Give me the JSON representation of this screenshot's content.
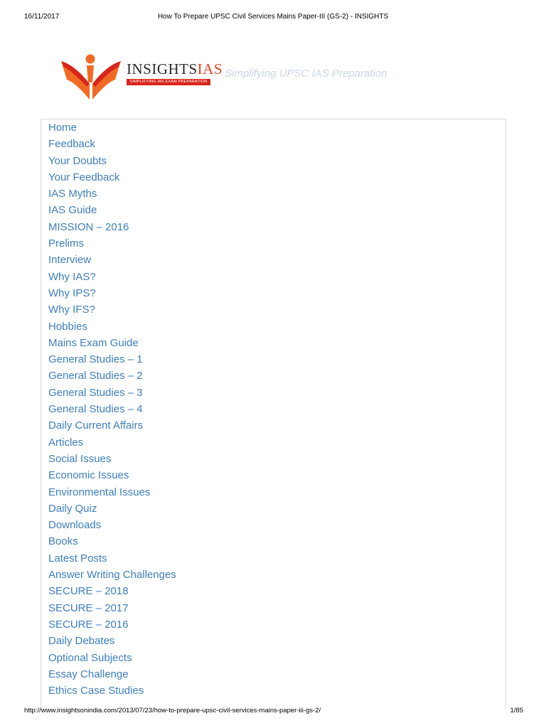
{
  "print_header": {
    "date": "16/11/2017",
    "title": "How To Prepare UPSC Civil Services Mains Paper-III (GS-2) - INSIGHTS"
  },
  "logo": {
    "name_main": "INSIGHTS",
    "name_accent": "IAS",
    "banner": "SIMPLIFYING IAS EXAM PREPARATION",
    "icon": "person-reading-book-icon",
    "colors": {
      "orange": "#f06a23",
      "red": "#d8251c"
    }
  },
  "tagline": "Simplifying UPSC IAS Preparation",
  "menu": {
    "link_color": "#3d7fbd",
    "items": [
      "Home",
      "Feedback",
      "Your Doubts",
      "Your Feedback",
      "IAS Myths",
      "IAS Guide",
      "MISSION – 2016",
      "Prelims",
      "Interview",
      "Why IAS?",
      "Why IPS?",
      "Why IFS?",
      "Hobbies",
      "Mains Exam Guide",
      "General Studies – 1",
      "General Studies – 2",
      "General Studies – 3",
      "General Studies – 4",
      "Daily Current Affairs",
      "Articles",
      "Social Issues",
      "Economic Issues",
      "Environmental Issues",
      "Daily Quiz",
      "Downloads",
      "Books",
      "Latest Posts",
      "Answer Writing Challenges",
      "SECURE – 2018",
      "SECURE – 2017",
      "SECURE – 2016",
      "Daily Debates",
      "Optional Subjects",
      "Essay Challenge",
      "Ethics Case Studies"
    ]
  },
  "print_footer": {
    "url": "http://www.insightsonindia.com/2013/07/23/how-to-prepare-upsc-civil-services-mains-paper-iii-gs-2/",
    "page": "1/85"
  }
}
